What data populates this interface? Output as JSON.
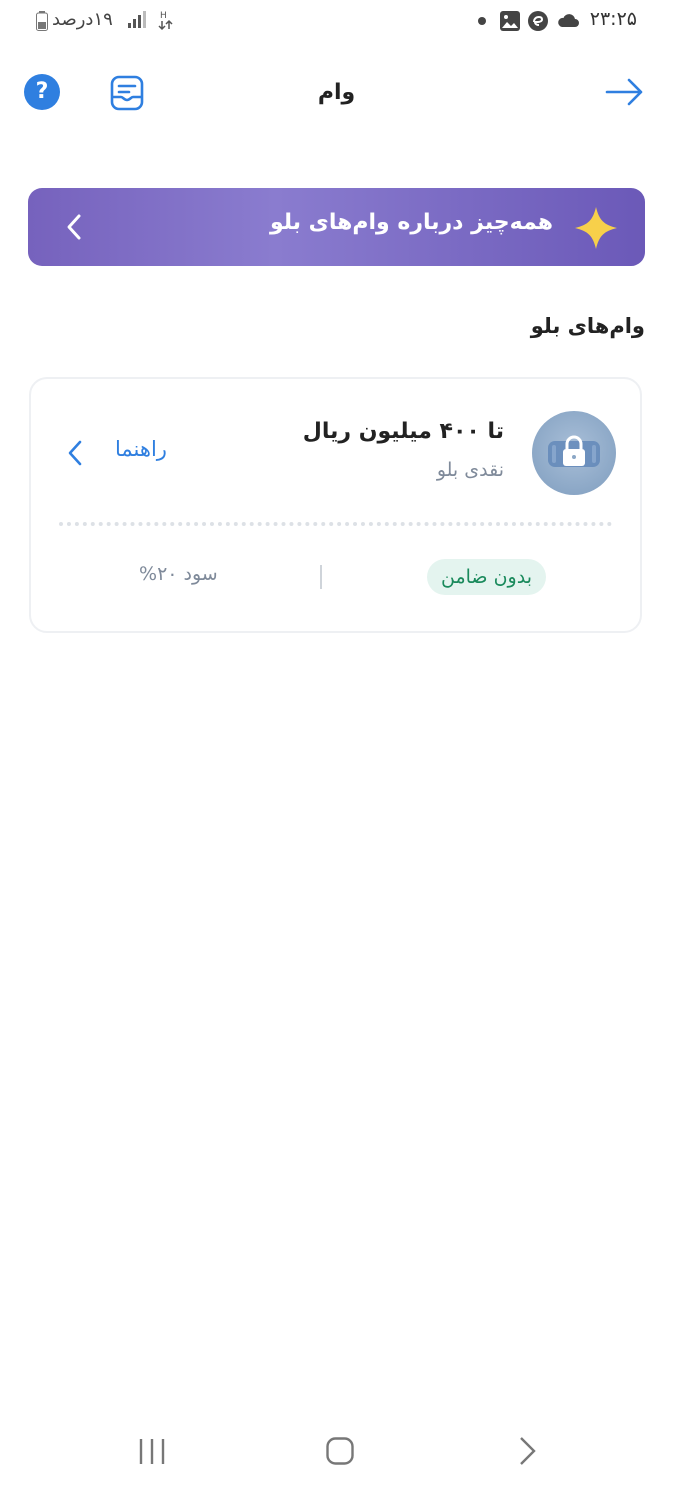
{
  "status_bar": {
    "time": "۲۳:۲۵",
    "battery_text": "۱۹درصد",
    "icons": [
      "cloud-icon",
      "app-notification-icon",
      "gallery-icon",
      "notification-dot",
      "data-arrows-icon",
      "signal-icon",
      "battery-icon"
    ]
  },
  "header": {
    "title": "وام",
    "back_icon": "arrow-right-icon",
    "receipt_icon": "receipt-icon",
    "help_label": "?"
  },
  "banner": {
    "text": "همه‌چیز درباره وام‌های بلو",
    "icon": "sparkle-icon",
    "chevron": "chevron-left-icon"
  },
  "section": {
    "title": "وام‌های بلو"
  },
  "loan_card": {
    "amount": "تا ۴۰۰ میلیون ریال",
    "type": "نقدی بلو",
    "guide_label": "راهنما",
    "badge": "بدون ضامن",
    "profit": "سود ۲۰%",
    "icon": "lock-wallet-icon"
  },
  "colors": {
    "accent": "#2f7fe0",
    "banner_start": "#7662bd",
    "banner_end": "#6b59b8",
    "badge_bg": "#e4f4ef",
    "badge_text": "#1a8a5c"
  },
  "nav_bar": {
    "icons": [
      "recents-icon",
      "home-icon",
      "back-icon"
    ]
  }
}
